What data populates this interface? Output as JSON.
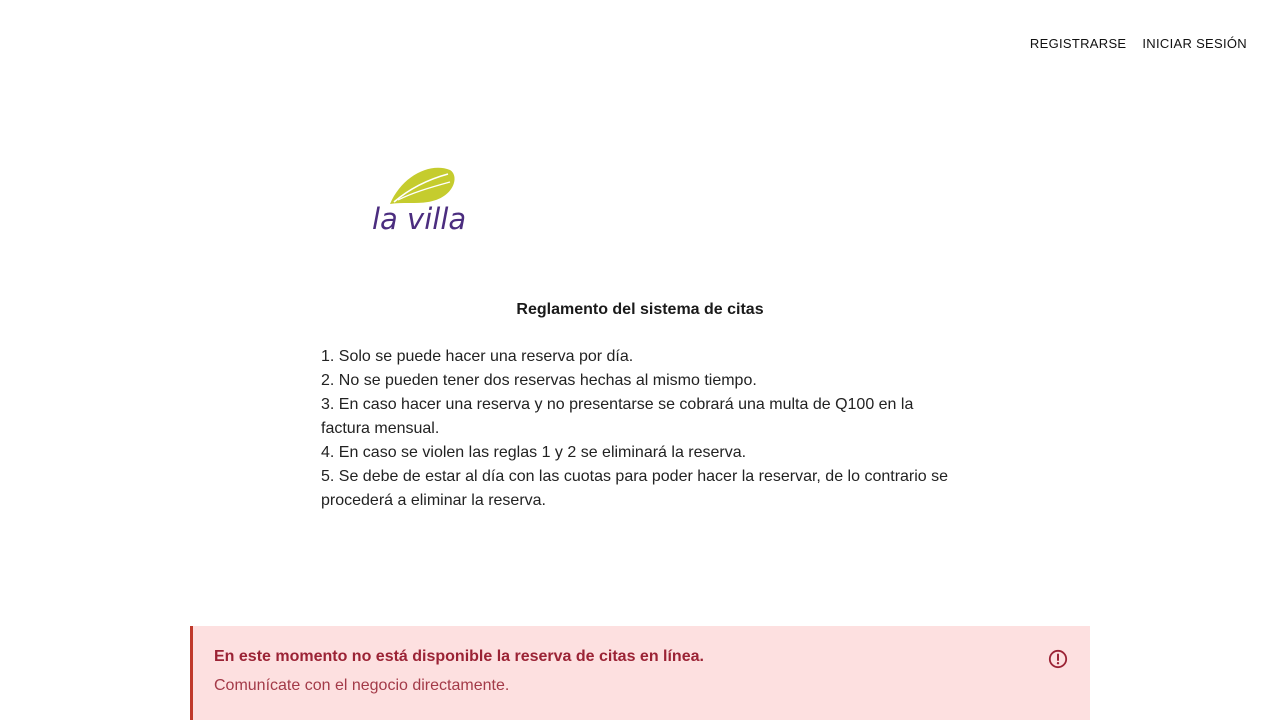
{
  "nav": {
    "register_label": "REGISTRARSE",
    "login_label": "INICIAR SESIÓN"
  },
  "logo": {
    "text": "la villa",
    "leaf_color": "#c5cc2e",
    "text_color": "#4b2d7f"
  },
  "rules": {
    "title": "Reglamento del sistema de citas",
    "items": [
      "1. Solo se puede hacer una reserva por día.",
      "2. No se pueden tener dos reservas hechas al mismo tiempo.",
      "3. En caso hacer una reserva y no presentarse se cobrará una multa de Q100 en la factura mensual.",
      "4. En caso se violen las reglas 1 y 2 se eliminará la reserva.",
      "5. Se debe de estar al día con las cuotas para poder hacer la reservar, de lo contrario se procederá a eliminar la reserva."
    ]
  },
  "alert": {
    "title": "En este momento no está disponible la reserva de citas en línea.",
    "message": "Comunícate con el negocio directamente.",
    "icon": "alert-circle-icon",
    "background_color": "#fde0e0",
    "accent_color": "#9b2335"
  }
}
